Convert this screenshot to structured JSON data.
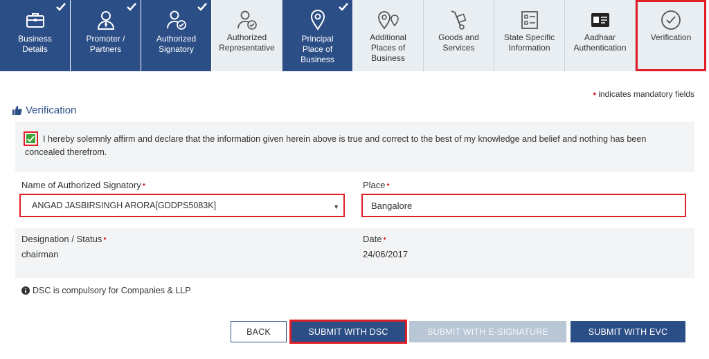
{
  "tabs": [
    {
      "label": "Business Details",
      "lines": [
        "Business",
        "Details"
      ],
      "state": "done",
      "icon": "briefcase-icon"
    },
    {
      "label": "Promoter / Partners",
      "lines": [
        "Promoter /",
        "Partners"
      ],
      "state": "done",
      "icon": "person-tie-icon"
    },
    {
      "label": "Authorized Signatory",
      "lines": [
        "Authorized",
        "Signatory"
      ],
      "state": "done",
      "icon": "person-check-icon"
    },
    {
      "label": "Authorized Representative",
      "lines": [
        "Authorized",
        "Representative"
      ],
      "state": "todo",
      "icon": "person-check-icon"
    },
    {
      "label": "Principal Place of Business",
      "lines": [
        "Principal",
        "Place of",
        "Business"
      ],
      "state": "done",
      "icon": "location-pin-icon"
    },
    {
      "label": "Additional Places of Business",
      "lines": [
        "Additional",
        "Places of",
        "Business"
      ],
      "state": "todo",
      "icon": "multi-pin-icon"
    },
    {
      "label": "Goods and Services",
      "lines": [
        "Goods and",
        "Services"
      ],
      "state": "todo",
      "icon": "hand-truck-icon"
    },
    {
      "label": "State Specific Information",
      "lines": [
        "State Specific",
        "Information"
      ],
      "state": "todo",
      "icon": "form-list-icon"
    },
    {
      "label": "Aadhaar Authentication",
      "lines": [
        "Aadhaar",
        "Authentication"
      ],
      "state": "todo",
      "icon": "id-card-icon"
    },
    {
      "label": "Verification",
      "lines": [
        "Verification"
      ],
      "state": "active",
      "icon": "circle-check-icon"
    }
  ],
  "mandatory_note": "indicates mandatory fields",
  "section_title": "Verification",
  "declaration": {
    "checked": true,
    "text": "I hereby solemnly affirm and declare that the information given herein above is true and correct to the best of my knowledge and belief and nothing has been concealed therefrom."
  },
  "form": {
    "signatory_label": "Name of Authorized Signatory",
    "signatory_value": "ANGAD JASBIRSINGH ARORA[GDDPS5083K]",
    "place_label": "Place",
    "place_value": "Bangalore",
    "designation_label": "Designation / Status",
    "designation_value": "chairman",
    "date_label": "Date",
    "date_value": "24/06/2017"
  },
  "note": "DSC is compulsory for Companies & LLP",
  "buttons": {
    "back": "BACK",
    "submit_dsc": "SUBMIT WITH DSC",
    "submit_esign": "SUBMIT WITH E-SIGNATURE",
    "submit_evc": "SUBMIT WITH EVC"
  },
  "colors": {
    "primary": "#2c4e86",
    "highlight": "#e01e26",
    "checkbox": "#3aa435",
    "disabled": "#b9c6d6"
  }
}
